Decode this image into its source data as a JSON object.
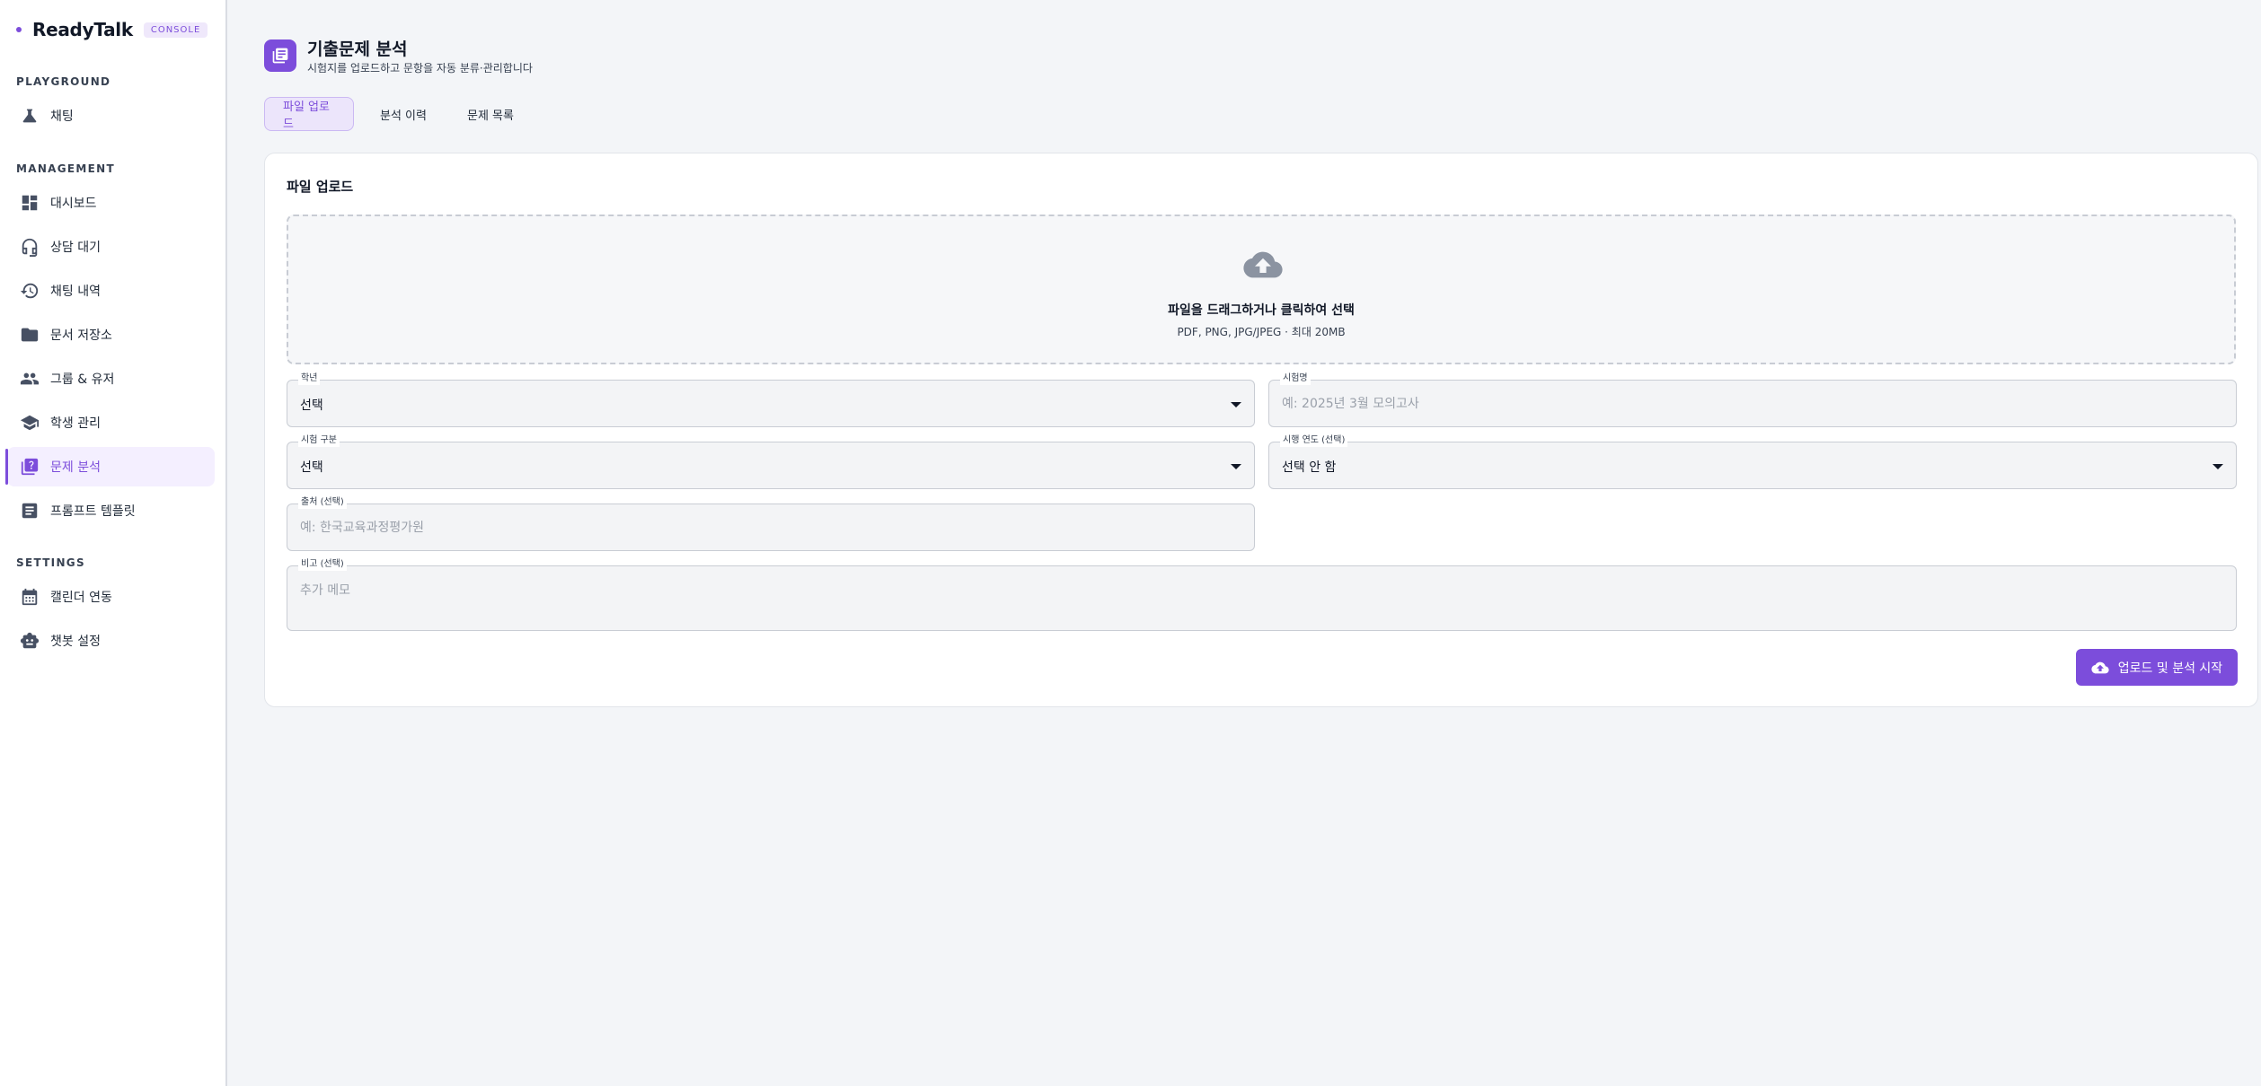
{
  "app": {
    "brand": "ReadyTalk",
    "badge": "CONSOLE"
  },
  "sidebar": {
    "sections": [
      {
        "title": "PLAYGROUND"
      },
      {
        "title": "MANAGEMENT"
      },
      {
        "title": "SETTINGS"
      }
    ],
    "items": [
      {
        "label": "채팅",
        "icon": "flask-icon"
      },
      {
        "label": "대시보드",
        "icon": "dashboard-icon"
      },
      {
        "label": "상담 대기",
        "icon": "headset-icon"
      },
      {
        "label": "채팅 내역",
        "icon": "history-icon"
      },
      {
        "label": "문서 저장소",
        "icon": "folder-icon"
      },
      {
        "label": "그룹 & 유저",
        "icon": "people-icon"
      },
      {
        "label": "학생 관리",
        "icon": "school-icon"
      },
      {
        "label": "문제 분석",
        "icon": "quiz-icon",
        "active": true
      },
      {
        "label": "프롬프트 템플릿",
        "icon": "article-icon"
      },
      {
        "label": "캘린더 연동",
        "icon": "calendar-icon"
      },
      {
        "label": "챗봇 설정",
        "icon": "robot-icon"
      }
    ]
  },
  "header": {
    "title": "기출문제 분석",
    "subtitle": "시험지를 업로드하고 문항을 자동 분류·관리합니다"
  },
  "tabs": [
    {
      "label": "파일 업로드",
      "active": true
    },
    {
      "label": "분석 이력"
    },
    {
      "label": "문제 목록"
    }
  ],
  "upload": {
    "card_title": "파일 업로드",
    "dropzone_text": "파일을 드래그하거나 클릭하여 선택",
    "dropzone_hint": "PDF, PNG, JPG/JPEG · 최대 20MB"
  },
  "form": {
    "grade": {
      "label": "학년",
      "value": "선택"
    },
    "exam_name": {
      "label": "시험명",
      "placeholder": "예: 2025년 3월 모의고사"
    },
    "exam_type": {
      "label": "시험 구분",
      "value": "선택"
    },
    "exam_year": {
      "label": "시행 연도 (선택)",
      "value": "선택 안 함"
    },
    "source": {
      "label": "출처 (선택)",
      "placeholder": "예: 한국교육과정평가원"
    },
    "note": {
      "label": "비고 (선택)",
      "placeholder": "추가 메모"
    }
  },
  "submit": {
    "label": "업로드 및 분석 시작",
    "icon": "cloud-upload-icon"
  },
  "colors": {
    "accent": "#7c4ddb",
    "accent_light": "#ece5fb",
    "background": "#f3f5f8"
  }
}
